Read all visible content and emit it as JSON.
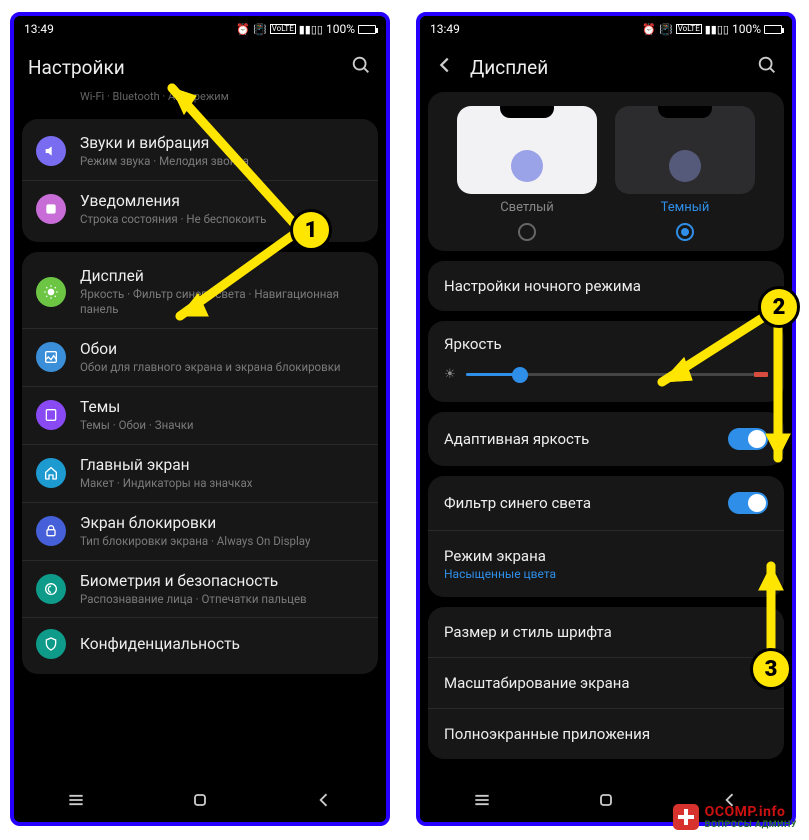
{
  "statusbar": {
    "time": "13:49",
    "battery": "100%"
  },
  "left": {
    "title": "Настройки",
    "faded": "Wi-Fi  ·  Bluetooth  ·  Авиарежим",
    "items": [
      {
        "title": "Звуки и вибрация",
        "sub": "Режим звука · Мелодия звонка"
      },
      {
        "title": "Уведомления",
        "sub": "Строка состояния · Не беспокоить"
      },
      {
        "title": "Дисплей",
        "sub": "Яркость · Фильтр синего света · Навигационная панель"
      },
      {
        "title": "Обои",
        "sub": "Обои для главного экрана и экрана блокировки"
      },
      {
        "title": "Темы",
        "sub": "Темы · Обои · Значки"
      },
      {
        "title": "Главный экран",
        "sub": "Макет · Индикаторы на значках"
      },
      {
        "title": "Экран блокировки",
        "sub": "Тип блокировки экрана · Always On Display"
      },
      {
        "title": "Биометрия и безопасность",
        "sub": "Распознавание лица · Отпечатки пальцев"
      },
      {
        "title": "Конфиденциальность",
        "sub": ""
      }
    ]
  },
  "right": {
    "title": "Дисплей",
    "theme": {
      "light": "Светлый",
      "dark": "Темный"
    },
    "night_mode": "Настройки ночного режима",
    "brightness": "Яркость",
    "brightness_pct": 18,
    "adaptive": "Адаптивная яркость",
    "blue_filter": "Фильтр синего света",
    "screen_mode": "Режим экрана",
    "screen_mode_sub": "Насыщенные цвета",
    "font": "Размер и стиль шрифта",
    "zoom": "Масштабирование экрана",
    "fullscreen": "Полноэкранные приложения"
  },
  "badges": {
    "b1": "1",
    "b2": "2",
    "b3": "3"
  },
  "watermark": {
    "l1": "OCOMP.info",
    "l2": "ВОПРОСЫ АДМИНУ"
  }
}
